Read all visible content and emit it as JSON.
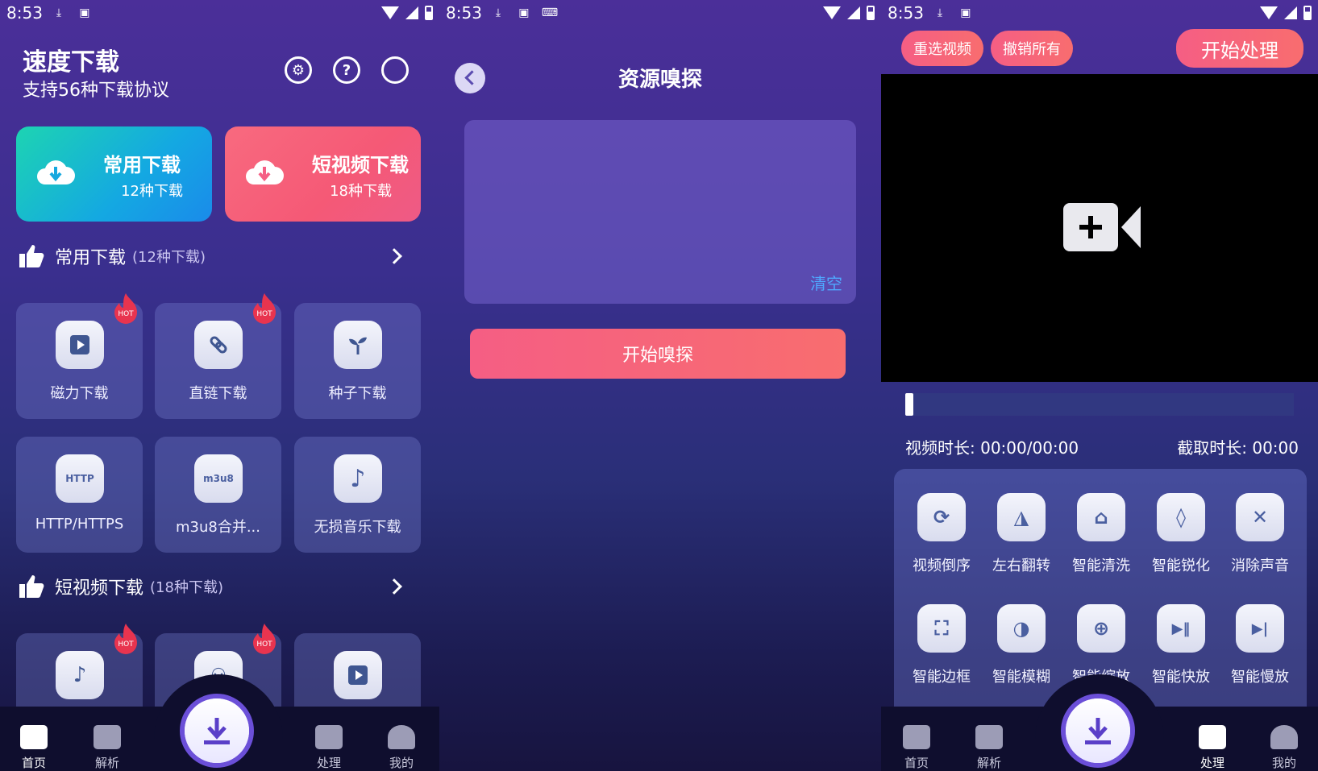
{
  "colors": {
    "accent_pink": "#f55e84",
    "accent_teal": "#1dd4b2",
    "link_blue": "#4fa8ff",
    "fab_border": "#6b4fd8"
  },
  "status": {
    "time": "8:53"
  },
  "home": {
    "title": "速度下载",
    "subtitle": "支持56种下载协议",
    "header_icons": [
      "gear-icon",
      "help-icon",
      "search-icon"
    ],
    "cards": [
      {
        "title": "常用下载",
        "sub": "12种下载"
      },
      {
        "title": "短视频下载",
        "sub": "18种下载"
      }
    ],
    "sections": [
      {
        "label": "常用下载",
        "count": "(12种下载)"
      },
      {
        "label": "短视频下载",
        "count": "(18种下载)"
      }
    ],
    "tiles": [
      {
        "label": "磁力下载",
        "icon": "play-icon",
        "hot": true
      },
      {
        "label": "直链下载",
        "icon": "link-icon",
        "hot": true
      },
      {
        "label": "种子下载",
        "icon": "sprout-icon",
        "hot": false
      },
      {
        "label": "HTTP/HTTPS",
        "icon_text": "HTTP",
        "icon": "http-icon",
        "hot": false
      },
      {
        "label": "m3u8合并...",
        "icon_text": "m3u8",
        "icon": "m3u8-icon",
        "hot": false
      },
      {
        "label": "无损音乐下载",
        "icon": "music-note-icon",
        "hot": false
      }
    ],
    "hot_badge": "HOT"
  },
  "nav": {
    "items": [
      "首页",
      "解析",
      "处理",
      "我的"
    ]
  },
  "sniff": {
    "title": "资源嗅探",
    "clear": "清空",
    "start": "开始嗅探"
  },
  "process": {
    "reselect": "重选视频",
    "undo_all": "撤销所有",
    "start": "开始处理",
    "duration_label": "视频时长: 00:00/00:00",
    "cut_label": "截取时长: 00:00",
    "tools": [
      {
        "label": "视频倒序",
        "icon": "refresh-icon",
        "glyph": "⟳"
      },
      {
        "label": "左右翻转",
        "icon": "flip-icon",
        "glyph": "◮"
      },
      {
        "label": "智能清洗",
        "icon": "broom-icon",
        "glyph": "⌂"
      },
      {
        "label": "智能锐化",
        "icon": "drop-icon",
        "glyph": "◊"
      },
      {
        "label": "消除声音",
        "icon": "mute-icon",
        "glyph": "✕"
      },
      {
        "label": "智能边框",
        "icon": "frame-icon",
        "glyph": "⛶"
      },
      {
        "label": "智能模糊",
        "icon": "blur-icon",
        "glyph": "◑"
      },
      {
        "label": "智能缩放",
        "icon": "zoom-icon",
        "glyph": "⊕"
      },
      {
        "label": "智能快放",
        "icon": "fast-play-icon",
        "glyph": "▶‖"
      },
      {
        "label": "智能慢放",
        "icon": "slow-play-icon",
        "glyph": "▶|"
      }
    ]
  }
}
